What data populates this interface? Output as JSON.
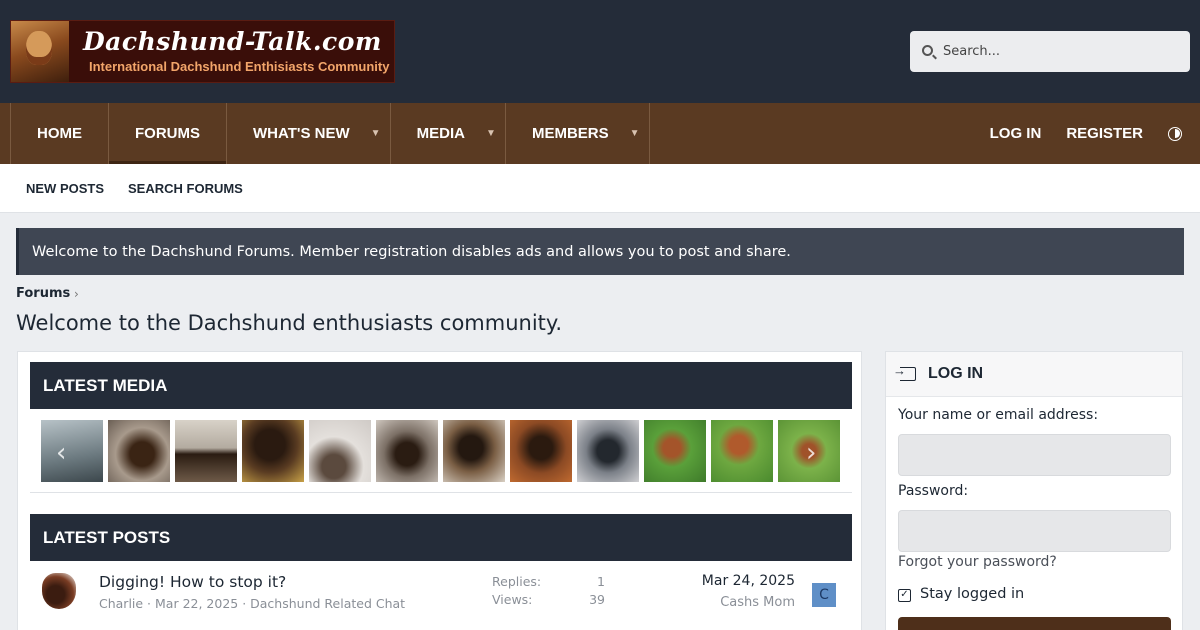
{
  "header": {
    "logo_title": "Dachshund-Talk.com",
    "logo_subtitle": "International Dachshund Enthisiasts Community",
    "search_placeholder": "Search..."
  },
  "nav": {
    "tabs": [
      {
        "label": "HOME",
        "has_menu": false
      },
      {
        "label": "FORUMS",
        "has_menu": false,
        "active": true
      },
      {
        "label": "WHAT'S NEW",
        "has_menu": true
      },
      {
        "label": "MEDIA",
        "has_menu": true
      },
      {
        "label": "MEMBERS",
        "has_menu": true
      }
    ],
    "login": "LOG IN",
    "register": "REGISTER"
  },
  "subnav": {
    "new_posts": "NEW POSTS",
    "search_forums": "SEARCH FORUMS"
  },
  "notice": "Welcome to the Dachshund Forums. Member registration disables ads and allows you to post and share.",
  "breadcrumb": "Forums",
  "page_title": "Welcome to the Dachshund enthusiasts community.",
  "latest_media": {
    "heading": "LATEST MEDIA",
    "thumbnails": [
      {
        "name": "water"
      },
      {
        "name": "dog-on-blanket"
      },
      {
        "name": "dog-on-floor"
      },
      {
        "name": "dog-on-yellow"
      },
      {
        "name": "dog-in-bed"
      },
      {
        "name": "dog-on-pillow"
      },
      {
        "name": "dog-sitting"
      },
      {
        "name": "dog-standing"
      },
      {
        "name": "dog-on-carpet"
      },
      {
        "name": "dog-in-grass-1"
      },
      {
        "name": "dog-in-grass-2"
      },
      {
        "name": "dog-in-grass-3"
      }
    ]
  },
  "latest_posts": {
    "heading": "LATEST POSTS",
    "posts": [
      {
        "title": "Digging! How to stop it?",
        "meta": "Charlie · Mar 22, 2025 · Dachshund Related Chat",
        "replies_label": "Replies:",
        "replies": "1",
        "views_label": "Views:",
        "views": "39",
        "last_date": "Mar 24, 2025",
        "last_user": "Cashs Mom",
        "last_user_initial": "C"
      }
    ]
  },
  "login_panel": {
    "heading": "LOG IN",
    "name_label": "Your name or email address:",
    "password_label": "Password:",
    "forgot": "Forgot your password?",
    "stay_logged_in": "Stay logged in"
  },
  "colors": {
    "header_bg": "#242c39",
    "nav_bg": "#5a3a22",
    "accent": "#4e2f1a",
    "avatar_bg": "#5f8fc7"
  }
}
